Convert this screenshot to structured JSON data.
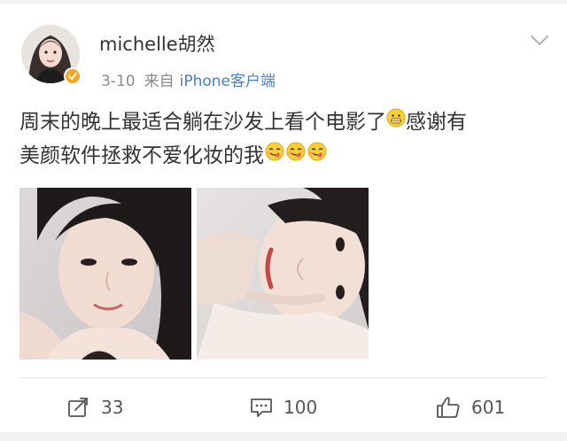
{
  "post": {
    "username": "michelle胡然",
    "date": "3-10",
    "from_label": "来自",
    "source": "iPhone客户端",
    "text_line1": "周末的晚上最适合躺在沙发上看个电影了",
    "text_line1b": "感谢有",
    "text_line2": "美颜软件拯救不爱化妆的我",
    "emoji_grin": "grinning-face-emoji",
    "emoji_yum": "face-savoring-food-emoji",
    "yum_count": 3
  },
  "actions": {
    "repost_count": "33",
    "comment_count": "100",
    "like_count": "601"
  },
  "colors": {
    "link": "#4a7fc1",
    "verified_badge": "#f5a623",
    "meta_gray": "#8a8a8a",
    "text": "#333333"
  },
  "icons": {
    "dropdown": "chevron-down-icon",
    "repost": "repost-icon",
    "comment": "comment-icon",
    "like": "thumbs-up-icon",
    "verified": "verified-badge-icon"
  }
}
